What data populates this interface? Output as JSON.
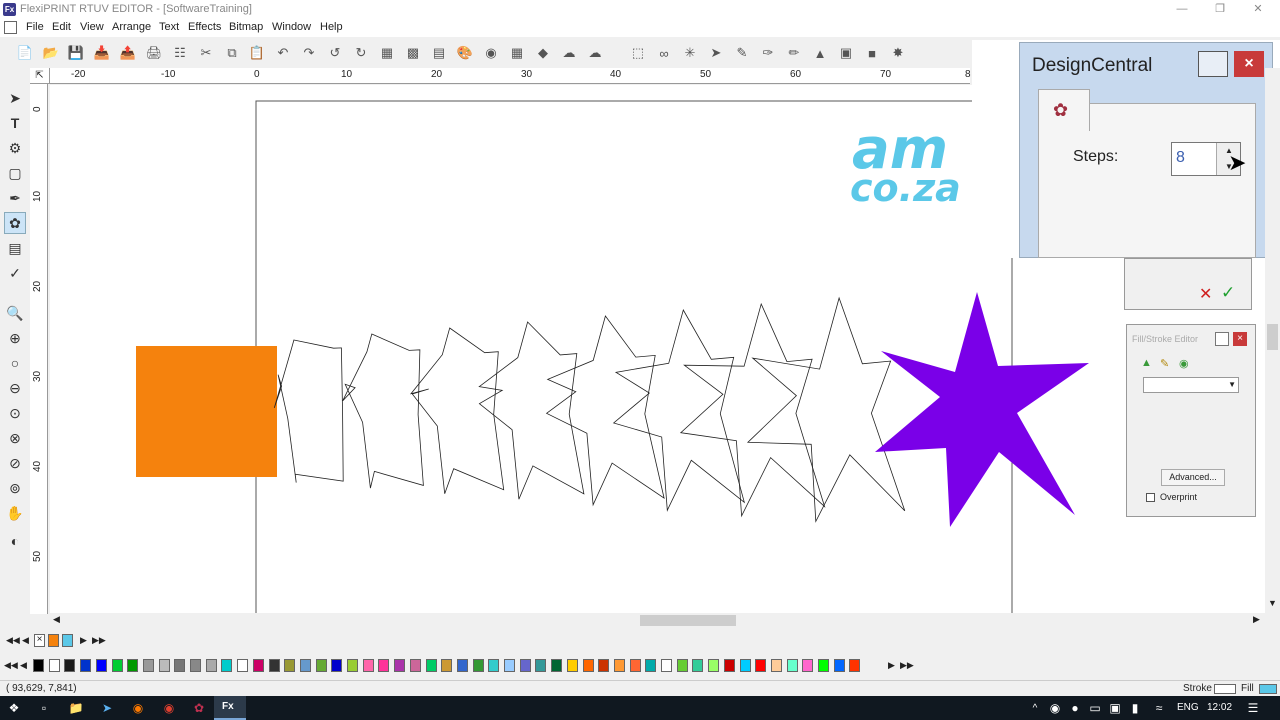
{
  "app": {
    "title": "FlexiPRINT RTUV EDITOR - [SoftwareTraining]",
    "icon_label": "Fx"
  },
  "menu": [
    "File",
    "Edit",
    "View",
    "Arrange",
    "Text",
    "Effects",
    "Bitmap",
    "Window",
    "Help"
  ],
  "ruler": {
    "top_labels": [
      "-20",
      "-10",
      "0",
      "10",
      "20",
      "30",
      "40",
      "50",
      "60",
      "70",
      "8"
    ],
    "left_labels": [
      "0",
      "10",
      "20",
      "30",
      "40",
      "50"
    ]
  },
  "canvas": {
    "logo_line1": "am",
    "logo_line2": "co.za",
    "logo_color": "#5bc8e8",
    "rect_color": "#f5820d",
    "star_color": "#7a00e8",
    "blend_steps_drawn": 8
  },
  "design_central": {
    "title": "DesignCentral",
    "steps_label": "Steps:",
    "steps_value": "8",
    "min_symbol": "—",
    "close_symbol": "×",
    "cancel_symbol": "✕",
    "ok_symbol": "✓"
  },
  "fill_stroke": {
    "title": "Fill/Stroke Editor",
    "advanced_label": "Advanced...",
    "overprint_label": "Overprint"
  },
  "status": {
    "coords": "( 93,629,    7,841)",
    "stroke_label": "Stroke",
    "fill_label": "Fill"
  },
  "taskbar": {
    "time": "12:02",
    "language": "ENG"
  },
  "icons": {
    "start": "windows-start-icon",
    "task_view": "task-view-icon",
    "explorer": "file-explorer-icon",
    "firefox": "firefox-icon",
    "chrome": "chrome-icon",
    "flexi": "flexi-app-icon"
  },
  "swatches": [
    "#000000",
    "#ffffff",
    "#1a1a1a",
    "#0033cc",
    "#0000ff",
    "#00cc33",
    "#009900",
    "#999999",
    "#bbbbbb",
    "#777777",
    "#888888",
    "#aaaaaa",
    "#00cccc",
    "#ffffff",
    "#cc0066",
    "#333333",
    "#999933",
    "#6699cc",
    "#66aa33",
    "#0000cc",
    "#99cc33",
    "#ff66aa",
    "#ff3399",
    "#aa33aa",
    "#cc6699",
    "#00cc66",
    "#cc9933",
    "#3366cc",
    "#339933",
    "#33cccc",
    "#99ccff",
    "#6666cc",
    "#339999",
    "#006633",
    "#ffcc00",
    "#ff6600",
    "#cc3300",
    "#ff9933",
    "#ff6633",
    "#00aaaa",
    "#ffffff",
    "#66cc33",
    "#33cc99",
    "#99ff66",
    "#cc0000",
    "#00ccff",
    "#ff0000",
    "#ffcc99",
    "#66ffcc",
    "#ff66cc",
    "#00ff00",
    "#0066ff",
    "#ff3300"
  ]
}
